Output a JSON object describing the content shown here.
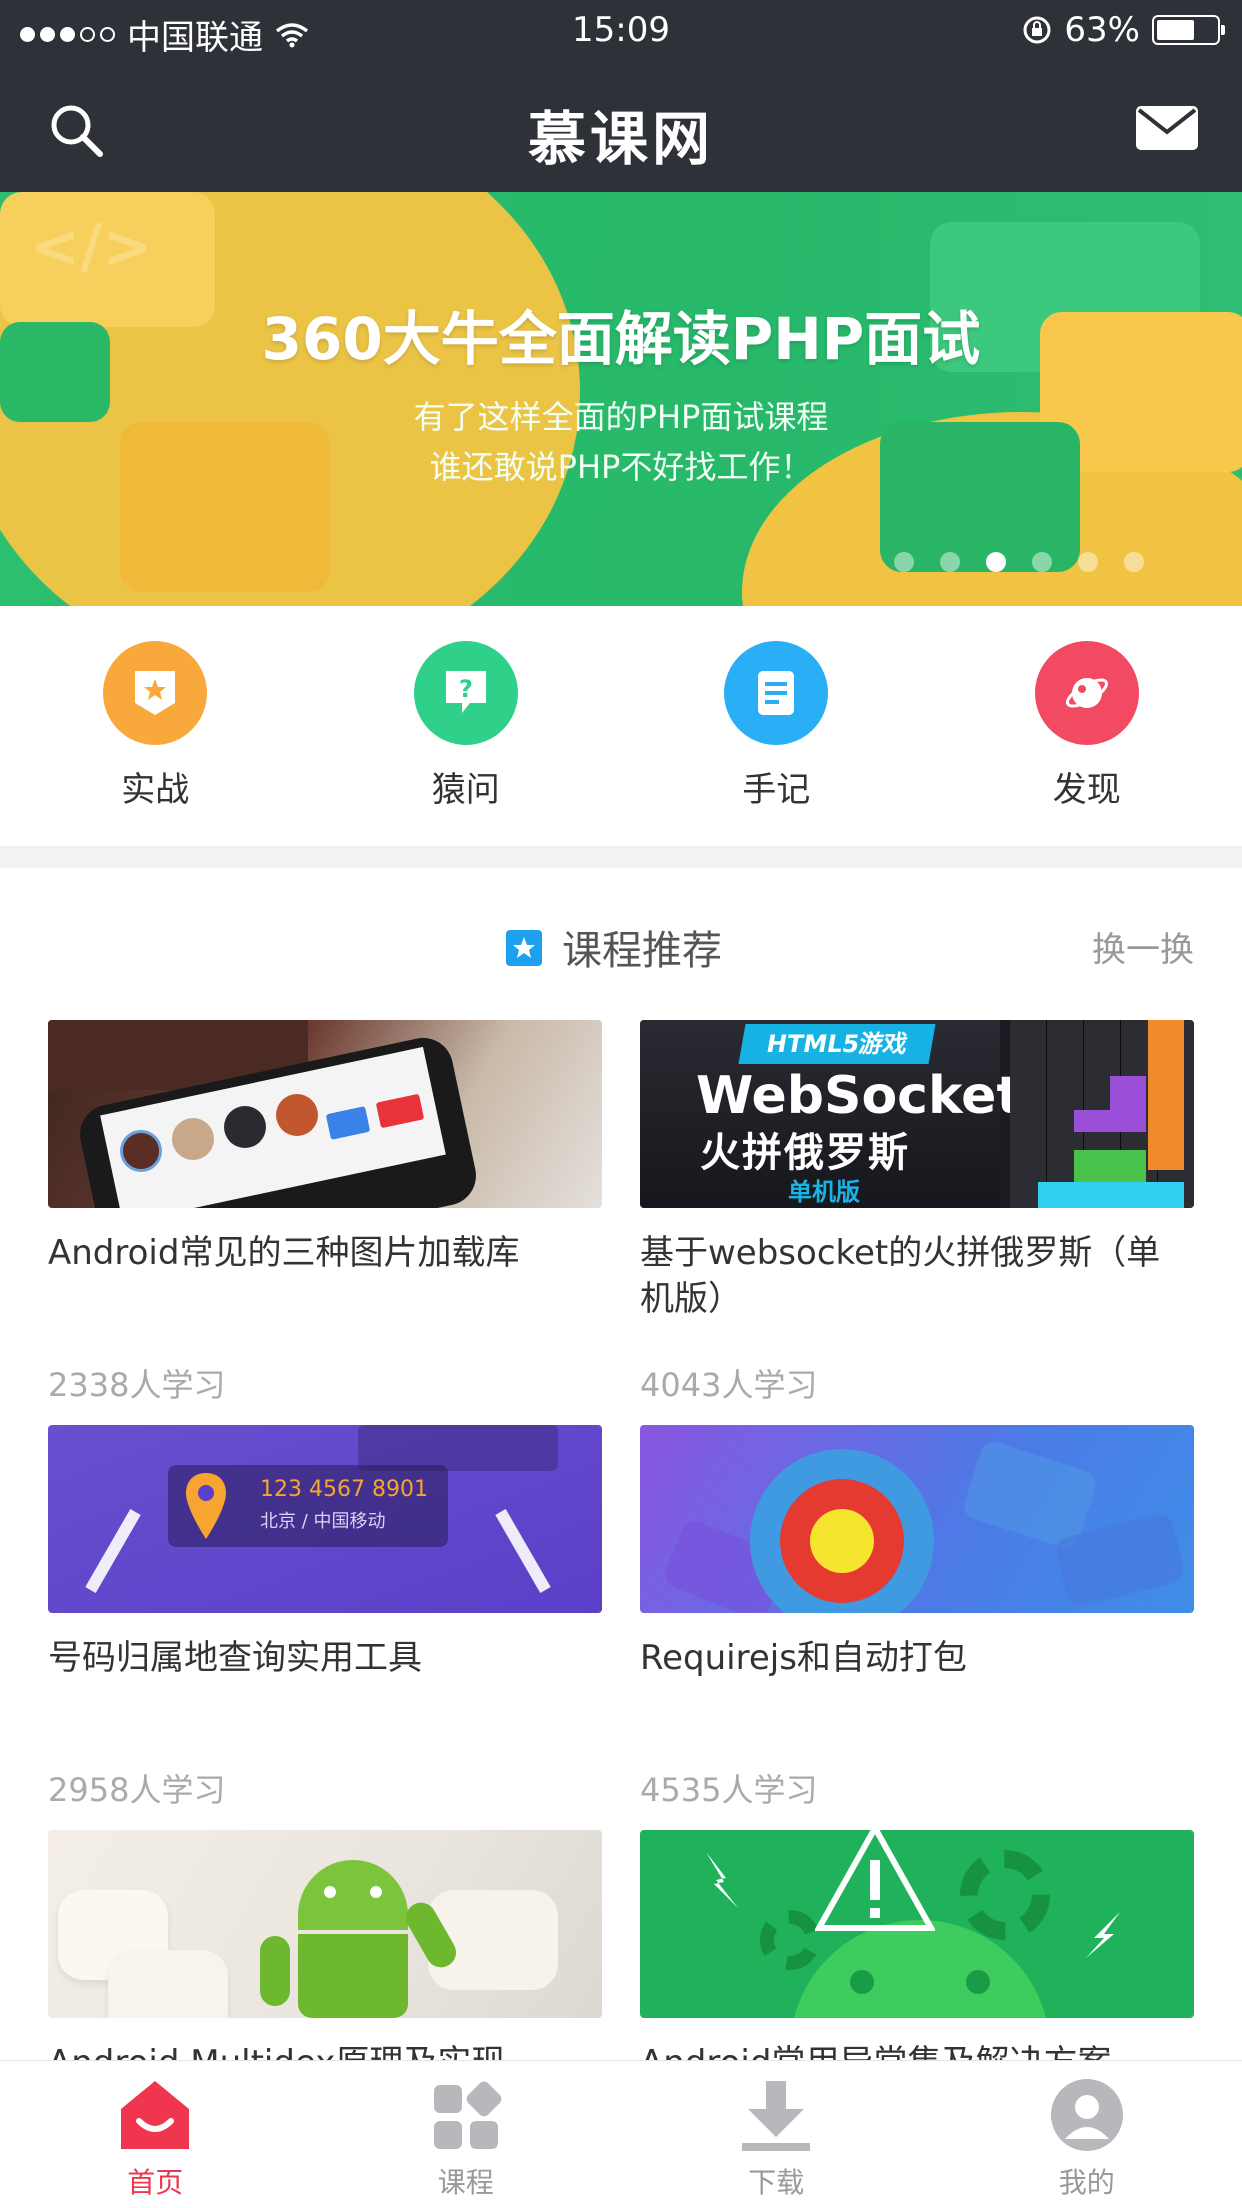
{
  "status_bar": {
    "carrier": "中国联通",
    "time": "15:09",
    "battery": "63%",
    "battery_level": 0.63
  },
  "header": {
    "title": "慕课网",
    "search_icon": "search-icon",
    "mail_icon": "mail-icon"
  },
  "banner": {
    "headline": "360大牛全面解读PHP面试",
    "sub1": "有了这样全面的PHP面试课程",
    "sub2": "谁还敢说PHP不好找工作！",
    "code_glyph": "</>",
    "page_count": 6,
    "active_page": 3
  },
  "quick_entries": [
    {
      "label": "实战",
      "icon": "star-badge-icon",
      "color": "#f9a93b"
    },
    {
      "label": "猿问",
      "icon": "question-bubble-icon",
      "color": "#2fd18a"
    },
    {
      "label": "手记",
      "icon": "note-icon",
      "color": "#2aaef5"
    },
    {
      "label": "发现",
      "icon": "planet-icon",
      "color": "#f24a63"
    }
  ],
  "recommend": {
    "title": "课程推荐",
    "refresh": "换一换"
  },
  "courses": [
    {
      "name": "Android常见的三种图片加载库",
      "learners": "2338人学习"
    },
    {
      "name": "基于websocket的火拼俄罗斯（单机版）",
      "learners": "4043人学习",
      "thumb_badge": "HTML5游戏",
      "thumb_title": "WebSocket",
      "thumb_sub": "火拼俄罗斯",
      "thumb_tag": "单机版"
    },
    {
      "name": "号码归属地查询实用工具",
      "learners": "2958人学习",
      "thumb_number": "123 4567 8901",
      "thumb_location": "北京 / 中国移动"
    },
    {
      "name": "Requirejs和自动打包",
      "learners": "4535人学习"
    },
    {
      "name": "Android Multidex原理及实现",
      "learners": ""
    },
    {
      "name": "Android常用异常集及解决方案",
      "learners": ""
    }
  ],
  "tabbar": [
    {
      "label": "首页",
      "icon": "home-icon",
      "active": true
    },
    {
      "label": "课程",
      "icon": "grid-icon",
      "active": false
    },
    {
      "label": "下载",
      "icon": "download-icon",
      "active": false
    },
    {
      "label": "我的",
      "icon": "user-icon",
      "active": false
    }
  ],
  "colors": {
    "header_bg": "#2f3138",
    "accent": "#f0364f",
    "rec_star": "#1ea0f0"
  }
}
